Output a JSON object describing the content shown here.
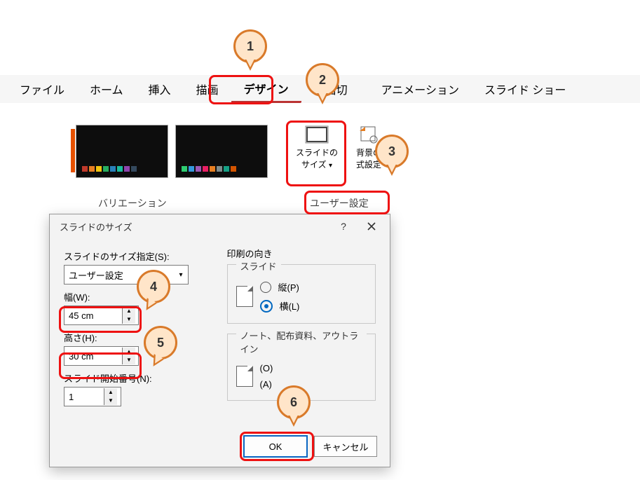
{
  "callouts": {
    "c1": "1",
    "c2": "2",
    "c3": "3",
    "c4": "4",
    "c5": "5",
    "c6": "6"
  },
  "ribbon": {
    "tabs": {
      "file": "ファイル",
      "home": "ホーム",
      "insert": "挿入",
      "draw": "描画",
      "design": "デザイン",
      "transitions": "画面切り替え",
      "transitions_cut": "画面切",
      "animations": "アニメーション",
      "slideshow": "スライド ショー"
    },
    "variants_label": "バリエーション",
    "slide_size": {
      "l1": "スライドの",
      "l2": "サイズ"
    },
    "bg": {
      "l1": "背景の",
      "l2": "式設定"
    },
    "user_setting": "ユーザー設定"
  },
  "dialog": {
    "title": "スライドのサイズ",
    "size_spec_label": "スライドのサイズ指定(S):",
    "size_spec_value": "ユーザー設定",
    "width_label": "幅(W):",
    "width_value": "45 cm",
    "height_label": "高さ(H):",
    "height_value": "30 cm",
    "start_label": "スライド開始番号(N):",
    "start_value": "1",
    "orient_title": "印刷の向き",
    "grp_slide": "スライド",
    "portrait": "縦(P)",
    "landscape": "横(L)",
    "grp_notes": "ノート、配布資料、アウトライン",
    "notes_portrait_hint": "(O)",
    "notes_landscape_hint": "(A)",
    "ok": "OK",
    "cancel": "キャンセル"
  }
}
